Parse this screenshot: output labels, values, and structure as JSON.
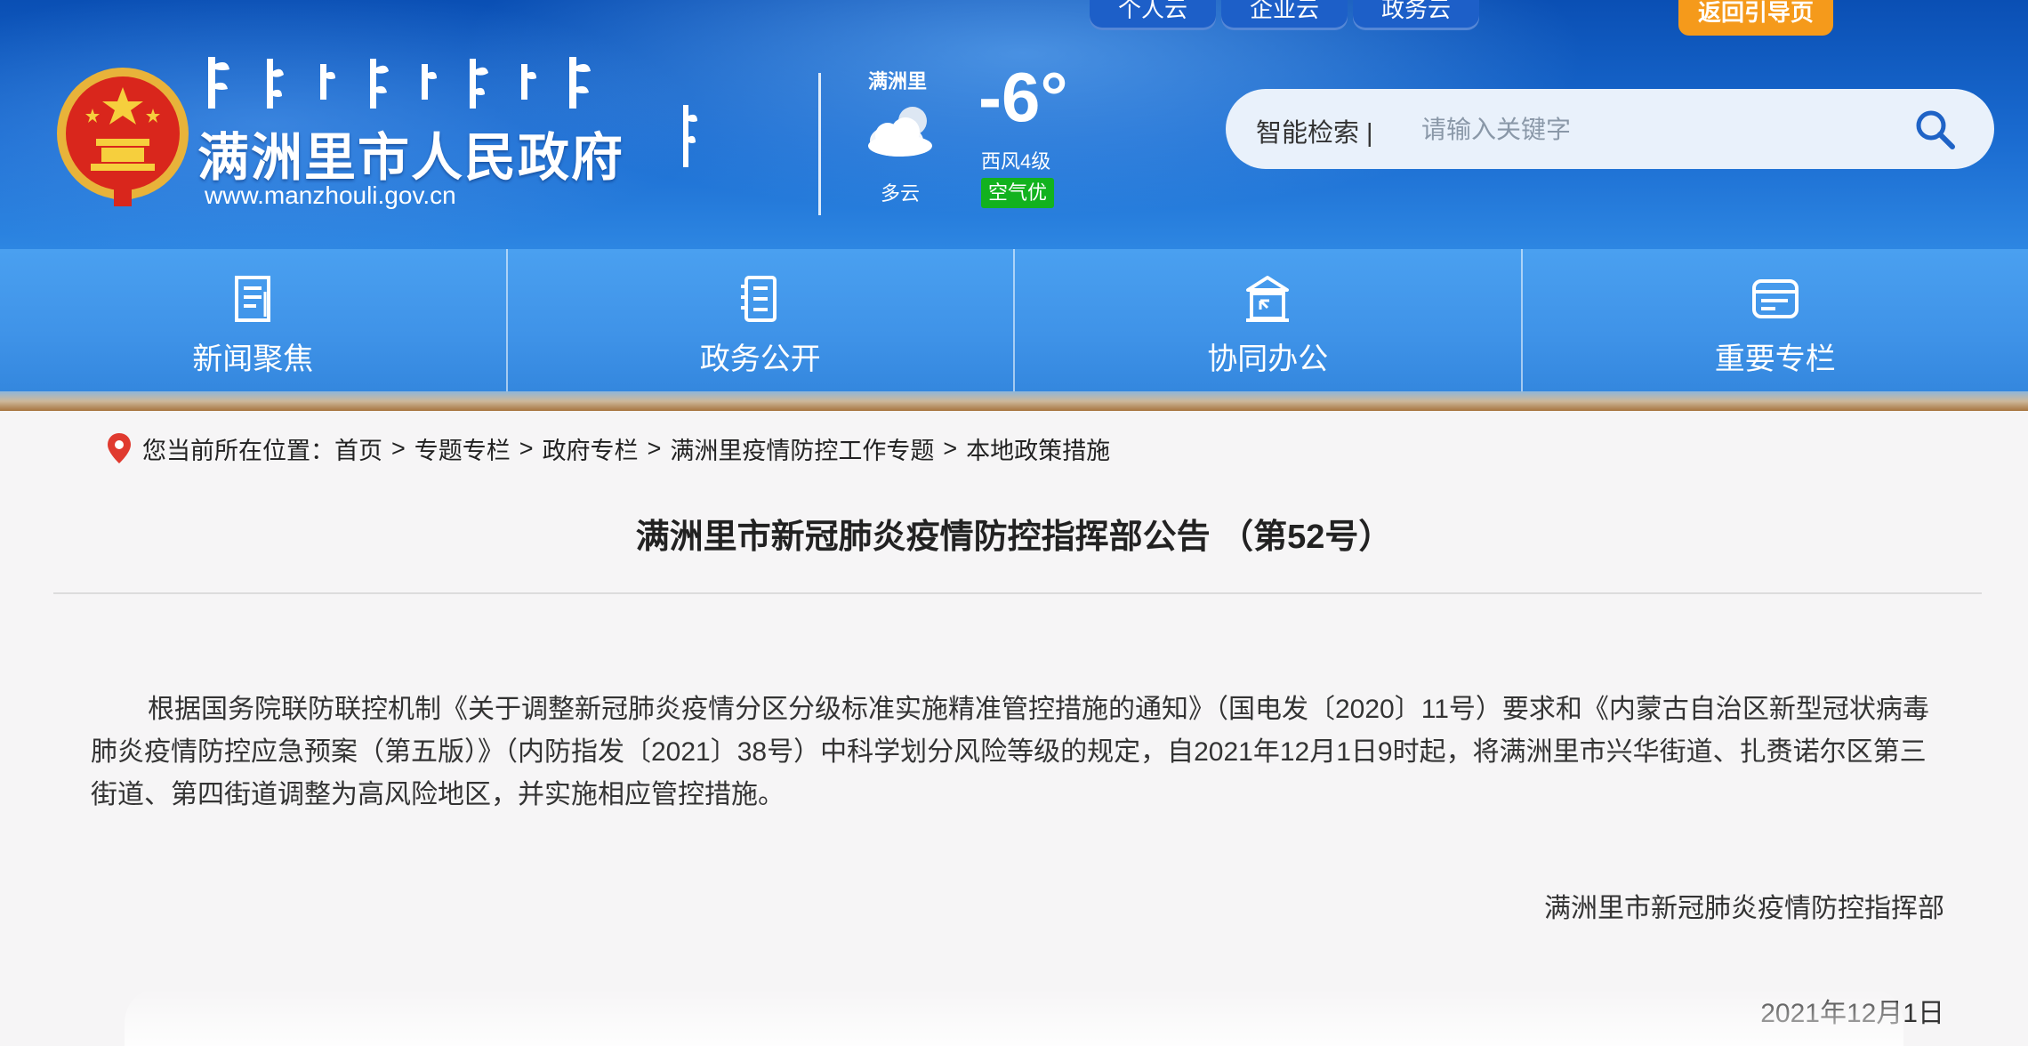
{
  "header": {
    "site_name": "满洲里市人民政府",
    "site_url": "www.manzhouli.gov.cn",
    "top_tabs": [
      "个人云",
      "企业云",
      "政务云"
    ],
    "return_label": "返回引导页",
    "weather": {
      "city": "满洲里",
      "condition": "多云",
      "temperature": "-6°",
      "wind": "西风4级",
      "air_quality": "空气优"
    },
    "search": {
      "label": "智能检索 |",
      "placeholder": "请输入关键字"
    }
  },
  "nav": {
    "items": [
      {
        "label": "新闻聚焦",
        "icon": "newspaper-icon"
      },
      {
        "label": "政务公开",
        "icon": "document-list-icon"
      },
      {
        "label": "协同办公",
        "icon": "building-icon"
      },
      {
        "label": "重要专栏",
        "icon": "card-icon"
      }
    ]
  },
  "breadcrumb": {
    "prefix": "您当前所在位置：",
    "items": [
      "首页",
      "专题专栏",
      "政府专栏",
      "满洲里疫情防控工作专题",
      "本地政策措施"
    ],
    "separator": ">"
  },
  "article": {
    "title": "满洲里市新冠肺炎疫情防控指挥部公告 （第52号）",
    "body": "根据国务院联防联控机制《关于调整新冠肺炎疫情分区分级标准实施精准管控措施的通知》（国电发〔2020〕11号）要求和《内蒙古自治区新型冠状病毒肺炎疫情防控应急预案（第五版）》（内防指发〔2021〕38号）中科学划分风险等级的规定，自2021年12月1日9时起，将满洲里市兴华街道、扎赉诺尔区第三街道、第四街道调整为高风险地区，并实施相应管控措施。",
    "signature": "满洲里市新冠肺炎疫情防控指挥部",
    "date": "2021年12月1日"
  },
  "colors": {
    "header_blue": "#0a4fb4",
    "nav_blue": "#3f93e8",
    "return_orange": "#f59a1b",
    "aqi_green": "#12b21e",
    "location_red": "#e03a2f"
  }
}
